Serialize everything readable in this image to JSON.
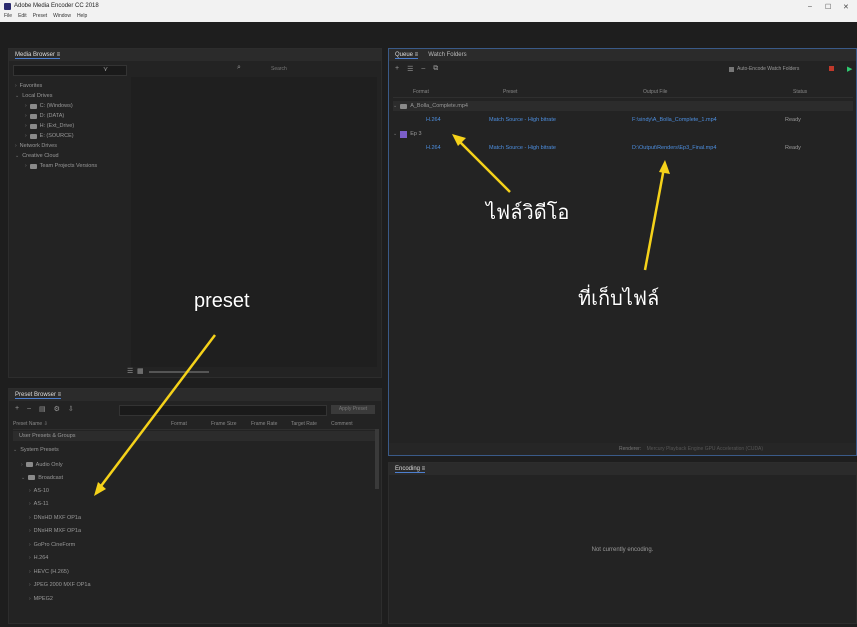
{
  "app": {
    "title": "Adobe Media Encoder CC 2018",
    "menu": [
      "File",
      "Edit",
      "Preset",
      "Window",
      "Help"
    ],
    "window_controls": [
      "–",
      "☐",
      "✕"
    ]
  },
  "media_browser": {
    "tab_label": "Media Browser ≡",
    "sections": [
      {
        "label": "Favorites",
        "level": 0,
        "arrow": "›"
      },
      {
        "label": "Local Drives",
        "level": 0,
        "arrow": "⌄"
      },
      {
        "label": "C: (Windows)",
        "level": 1,
        "arrow": "›"
      },
      {
        "label": "D: (DATA)",
        "level": 1,
        "arrow": "›"
      },
      {
        "label": "H: (Ext_Drive)",
        "level": 1,
        "arrow": "›"
      },
      {
        "label": "E: (SOURCE)",
        "level": 1,
        "arrow": "›"
      },
      {
        "label": "Network Drives",
        "level": 0,
        "arrow": "›"
      },
      {
        "label": "Creative Cloud",
        "level": 0,
        "arrow": "⌄"
      },
      {
        "label": "Team Projects Versions",
        "level": 1,
        "arrow": "›"
      }
    ],
    "search_placeholder": "Search"
  },
  "preset_browser": {
    "tab_label": "Preset Browser ≡",
    "columns": [
      "Preset Name ⇩",
      "Format",
      "Frame Size",
      "Frame Rate",
      "Target Rate",
      "Comment"
    ],
    "apply_button": "Apply Preset",
    "user_presets_label": "User Presets & Groups",
    "system_presets_label": "System Presets",
    "groups": [
      {
        "label": "Audio Only",
        "level": 1,
        "arrow": "›"
      },
      {
        "label": "Broadcast",
        "level": 1,
        "arrow": "⌄"
      }
    ],
    "items": [
      "AS-10",
      "AS-11",
      "DNxHD MXF OP1a",
      "DNxHR MXF OP1a",
      "GoPro CineForm",
      "H.264",
      "HEVC (H.265)",
      "JPEG 2000 MXF OP1a",
      "MPEG2"
    ]
  },
  "queue": {
    "tabs": [
      "Queue ≡",
      "Watch Folders"
    ],
    "auto_encode_label": "Auto-Encode Watch Folders",
    "columns": [
      "Format",
      "Preset",
      "Output File",
      "Status"
    ],
    "groups": [
      {
        "name": "A_Bolla_Complete.mp4",
        "row": {
          "format": "H.264",
          "preset": "Match Source - High bitrate",
          "output": "F:\\sindy\\A_Bolla_Complete_1.mp4",
          "status": "Ready"
        }
      },
      {
        "name": "Ep 3",
        "row": {
          "format": "H.264",
          "preset": "Match Source - High bitrate",
          "output": "D:\\Output\\Renders\\Ep3_Final.mp4",
          "status": "Ready"
        }
      }
    ],
    "renderer_label": "Renderer:",
    "renderer_value": "Mercury Playback Engine GPU Acceleration (CUDA)"
  },
  "encoding": {
    "tab_label": "Encoding ≡",
    "status_text": "Not currently encoding."
  },
  "annotations": {
    "video_file": "ไฟล์วิดีโอ",
    "save_location": "ที่เก็บไฟล์",
    "preset": "preset"
  },
  "colors": {
    "accent": "#4d7fcf",
    "link": "#4d8fe0",
    "arrow": "#f5d21a"
  }
}
